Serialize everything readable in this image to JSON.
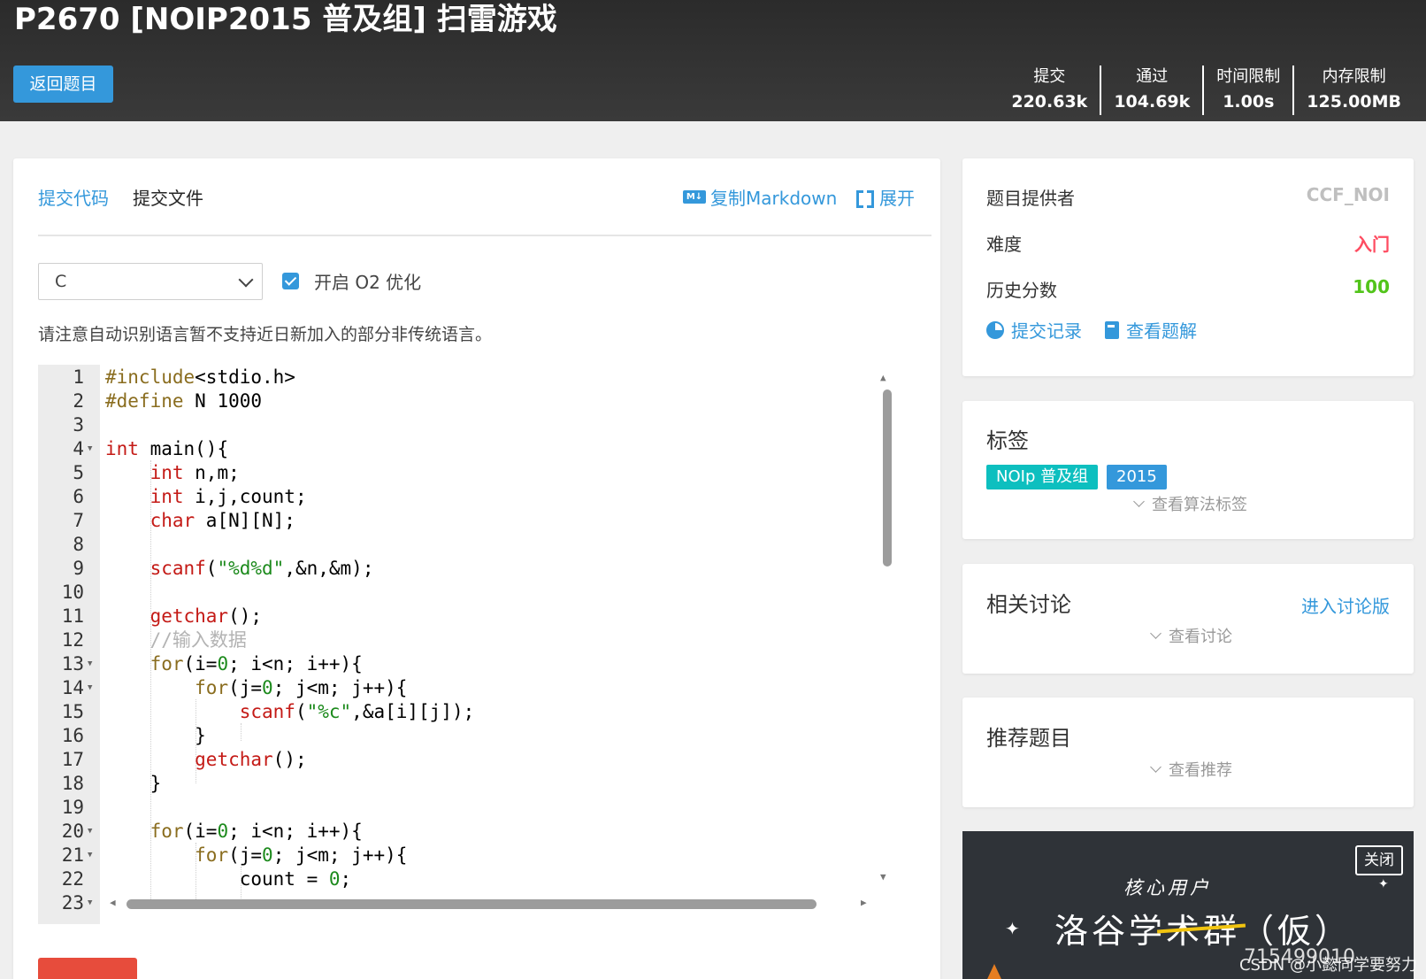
{
  "header": {
    "title": "P2670 [NOIP2015 普及组] 扫雷游戏",
    "back_label": "返回题目",
    "stats": [
      {
        "label": "提交",
        "value": "220.63k"
      },
      {
        "label": "通过",
        "value": "104.69k"
      },
      {
        "label": "时间限制",
        "value": "1.00s"
      },
      {
        "label": "内存限制",
        "value": "125.00MB"
      }
    ]
  },
  "editor_panel": {
    "tabs": [
      "提交代码",
      "提交文件"
    ],
    "copy_markdown": "复制Markdown",
    "md_badge": "M↓",
    "expand": "展开",
    "language": "C",
    "o2_label": "开启 O2 优化",
    "o2_checked": true,
    "notice": "请注意自动识别语言暂不支持近日新加入的部分非传统语言。",
    "line_numbers": [
      "1",
      "2",
      "3",
      "4",
      "5",
      "6",
      "7",
      "8",
      "9",
      "10",
      "11",
      "12",
      "13",
      "14",
      "15",
      "16",
      "17",
      "18",
      "19",
      "20",
      "21",
      "22",
      "23"
    ],
    "fold_lines": [
      4,
      13,
      14,
      20,
      21,
      23
    ]
  },
  "problem_info": {
    "provider_label": "题目提供者",
    "provider": "CCF_NOI",
    "difficulty_label": "难度",
    "difficulty": "入门",
    "difficulty_color": "#fe4c61",
    "score_label": "历史分数",
    "score": "100",
    "score_color": "#52c41a",
    "submissions_link": "提交记录",
    "solutions_link": "查看题解"
  },
  "tags_card": {
    "title": "标签",
    "tags": [
      {
        "label": "NOIp 普及组",
        "color": "#0dbfbf"
      },
      {
        "label": "2015",
        "color": "#3498db"
      }
    ],
    "more": "查看算法标签"
  },
  "discussion_card": {
    "title": "相关讨论",
    "link": "进入讨论版",
    "more": "查看讨论"
  },
  "recommend_card": {
    "title": "推荐题目",
    "more": "查看推荐"
  },
  "ad": {
    "close": "关闭",
    "subtitle": "核心用户",
    "headline": "洛谷学术群（仮）",
    "group_number": "715499010"
  },
  "watermark": "CSDN @小懿同学要努力"
}
